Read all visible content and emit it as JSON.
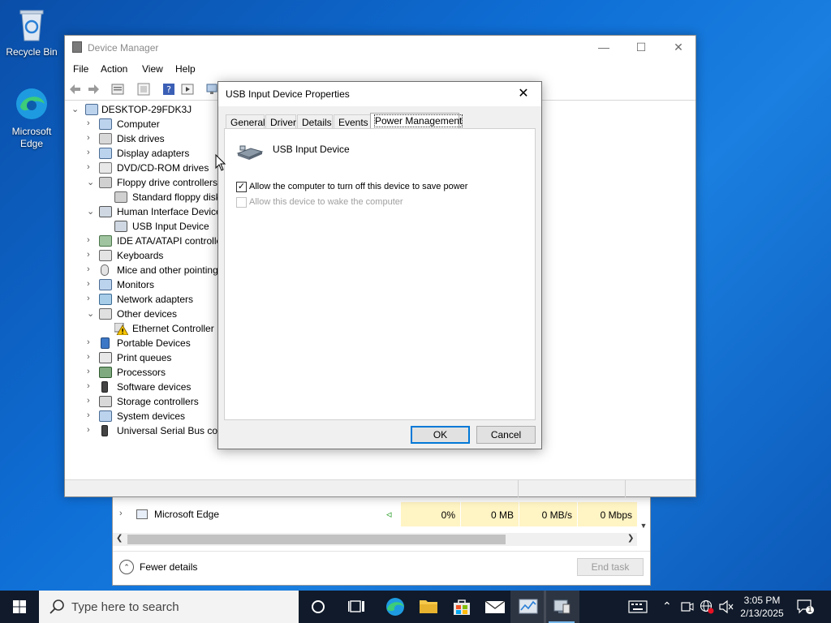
{
  "desktop": {
    "icons": [
      {
        "label": "Recycle Bin"
      },
      {
        "label": "Microsoft Edge"
      }
    ]
  },
  "task_manager": {
    "row": {
      "name": "Microsoft Edge",
      "cpu": "0%",
      "memory": "0 MB",
      "disk": "0 MB/s",
      "network": "0 Mbps"
    },
    "fewer_details": "Fewer details",
    "end_task": "End task"
  },
  "device_manager": {
    "title": "Device Manager",
    "menu": [
      "File",
      "Action",
      "View",
      "Help"
    ],
    "tree": [
      {
        "label": "DESKTOP-29FDK3J",
        "level": 0,
        "state": "expanded",
        "icon": "computer-root-icon"
      },
      {
        "label": "Computer",
        "level": 1,
        "state": "collapsed",
        "icon": "computer-icon"
      },
      {
        "label": "Disk drives",
        "level": 1,
        "state": "collapsed",
        "icon": "disk-icon"
      },
      {
        "label": "Display adapters",
        "level": 1,
        "state": "collapsed",
        "icon": "display-adapter-icon"
      },
      {
        "label": "DVD/CD-ROM drives",
        "level": 1,
        "state": "collapsed",
        "icon": "dvd-icon"
      },
      {
        "label": "Floppy drive controllers",
        "level": 1,
        "state": "expanded",
        "icon": "floppy-controller-icon"
      },
      {
        "label": "Standard floppy disk controller",
        "level": 2,
        "state": "leaf",
        "icon": "floppy-controller-icon"
      },
      {
        "label": "Human Interface Devices",
        "level": 1,
        "state": "expanded",
        "icon": "hid-icon"
      },
      {
        "label": "USB Input Device",
        "level": 2,
        "state": "leaf",
        "icon": "hid-icon"
      },
      {
        "label": "IDE ATA/ATAPI controllers",
        "level": 1,
        "state": "collapsed",
        "icon": "ide-icon"
      },
      {
        "label": "Keyboards",
        "level": 1,
        "state": "collapsed",
        "icon": "keyboard-icon"
      },
      {
        "label": "Mice and other pointing devices",
        "level": 1,
        "state": "collapsed",
        "icon": "mouse-icon"
      },
      {
        "label": "Monitors",
        "level": 1,
        "state": "collapsed",
        "icon": "monitor-icon"
      },
      {
        "label": "Network adapters",
        "level": 1,
        "state": "collapsed",
        "icon": "network-icon"
      },
      {
        "label": "Other devices",
        "level": 1,
        "state": "expanded",
        "icon": "other-devices-icon"
      },
      {
        "label": "Ethernet Controller",
        "level": 2,
        "state": "leaf",
        "icon": "warning-device-icon"
      },
      {
        "label": "Portable Devices",
        "level": 1,
        "state": "collapsed",
        "icon": "portable-icon"
      },
      {
        "label": "Print queues",
        "level": 1,
        "state": "collapsed",
        "icon": "printer-icon"
      },
      {
        "label": "Processors",
        "level": 1,
        "state": "collapsed",
        "icon": "processor-icon"
      },
      {
        "label": "Software devices",
        "level": 1,
        "state": "collapsed",
        "icon": "software-device-icon"
      },
      {
        "label": "Storage controllers",
        "level": 1,
        "state": "collapsed",
        "icon": "storage-icon"
      },
      {
        "label": "System devices",
        "level": 1,
        "state": "collapsed",
        "icon": "system-icon"
      },
      {
        "label": "Universal Serial Bus controllers",
        "level": 1,
        "state": "collapsed",
        "icon": "usb-icon"
      }
    ]
  },
  "dialog": {
    "title": "USB Input Device Properties",
    "tabs": [
      "General",
      "Driver",
      "Details",
      "Events",
      "Power Management"
    ],
    "active_tab": "Power Management",
    "device_name": "USB Input Device",
    "options": [
      {
        "label": "Allow the computer to turn off this device to save power",
        "checked": true,
        "enabled": true
      },
      {
        "label": "Allow this device to wake the computer",
        "checked": false,
        "enabled": false
      }
    ],
    "ok": "OK",
    "cancel": "Cancel"
  },
  "taskbar": {
    "search_placeholder": "Type here to search",
    "time": "3:05 PM",
    "date": "2/13/2025",
    "notification_count": "1"
  },
  "colors": {
    "accent": "#0078d7",
    "taskbar": "#101a2a",
    "desktop": "#0f6fd6",
    "highlight_cell": "#fff4c4"
  }
}
